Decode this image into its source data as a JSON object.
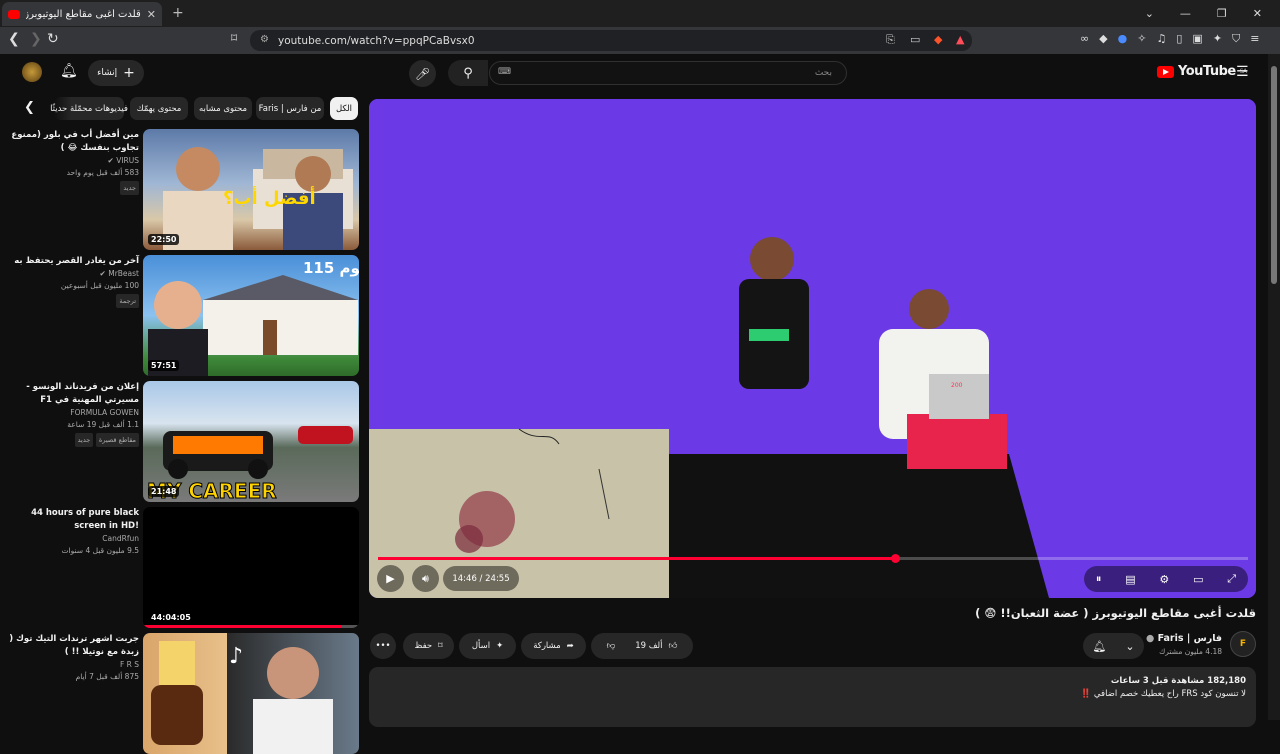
{
  "browser": {
    "tab_title": "قلدت أغبى مقاطع اليوتيوبرز ( عضة",
    "url": "youtube.com/watch?v=ppqPCaBvsx0"
  },
  "header": {
    "search_placeholder": "بحث",
    "create_label": "إنشاء",
    "logo_text": "YouTube",
    "logo_region": "SA"
  },
  "chips": [
    {
      "label": "الكل",
      "active": true
    },
    {
      "label": "من فارس | Faris",
      "active": false
    },
    {
      "label": "محتوى مشابه",
      "active": false
    },
    {
      "label": "محتوى يهمّك",
      "active": false
    },
    {
      "label": "فيديوهات محمّلة حديثًا",
      "active": false
    }
  ],
  "recommendations": [
    {
      "title": "مين أفضل أب في بلور (ممنوع تجاوب بنفسك 😂 )",
      "channel": "VIRUS",
      "verified": true,
      "stats": "583 ألف  قبل يوم واحد",
      "badge": "جديد",
      "duration": "22:50"
    },
    {
      "title": "آخر من يغادر القصر يحتفظ به",
      "channel": "MrBeast",
      "verified": true,
      "stats": "100 مليون  قبل أسبوعين",
      "badge": "ترجمة",
      "duration": "57:51"
    },
    {
      "title": "إعلان من فريدناند الونسو - مسيرتي المهنية في F1",
      "channel": "FORMULA GOWEN",
      "verified": false,
      "stats": "1.1 ألف  قبل 19 ساعة",
      "badge": "جديد",
      "badge2": "مقاطع قصيرة",
      "duration": "21:48",
      "overlay": "MY CAREER"
    },
    {
      "title": "44 hours of pure black screen in HD!",
      "channel": "CandRfun",
      "verified": false,
      "stats": "9.5 مليون  قبل 4 سنوات",
      "duration": "44:04:05"
    },
    {
      "title": "جربت اشهر ترندات التيك توك ( زبدة مع نوتيلا !! )",
      "channel": "F R S",
      "verified": false,
      "stats": "875 ألف  قبل 7 أيام",
      "duration": ""
    }
  ],
  "player": {
    "time": "14:46 / 24:55",
    "progress": 0.5947,
    "overlay_digits": "200"
  },
  "video": {
    "title": "قلدت أغبى مقاطع اليوتيوبرز ( عضة الثعبان!! 😨 )",
    "channel": "فارس | Faris",
    "subscribers": "4.18 مليون مشترك",
    "likes": "19 ألف",
    "share": "مشاركة",
    "ask": "اسأل",
    "save": "حفظ",
    "more": "•••",
    "views": "182,180 مشاهدة  قبل 3 ساعات",
    "desc_line": "لا تنسون كود FRS راح يعطيك خصم اضافي ‼️"
  }
}
